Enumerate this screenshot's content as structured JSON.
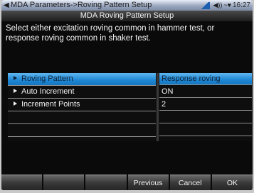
{
  "titlebar": {
    "back": "◀",
    "breadcrumb": "MDA Parameters->Roving Pattern Setup",
    "status_icons": [
      "signal-icon",
      "speaker-icon",
      "battery-icon"
    ],
    "speaker": "◀))",
    "battery": "~♥",
    "time": "16:27"
  },
  "subtitle": "MDA Roving Pattern Setup",
  "description": "Select either excitation roving  common in hammer test, or response roving common in shaker test.",
  "table": {
    "rows": [
      {
        "name": "Roving Pattern",
        "value": "Response roving",
        "selected": true
      },
      {
        "name": "Auto Increment",
        "value": "ON",
        "selected": false
      },
      {
        "name": "Increment Points",
        "value": "2",
        "selected": false
      },
      {
        "name": "",
        "value": "",
        "selected": false
      },
      {
        "name": "",
        "value": "",
        "selected": false
      }
    ]
  },
  "softkeys": [
    "",
    "",
    "",
    "Previous",
    "Cancel",
    "OK"
  ],
  "colors": {
    "selected_row": "#1d86d3",
    "background": "#0a0a0a",
    "titlebar": "#9aa7bf"
  }
}
